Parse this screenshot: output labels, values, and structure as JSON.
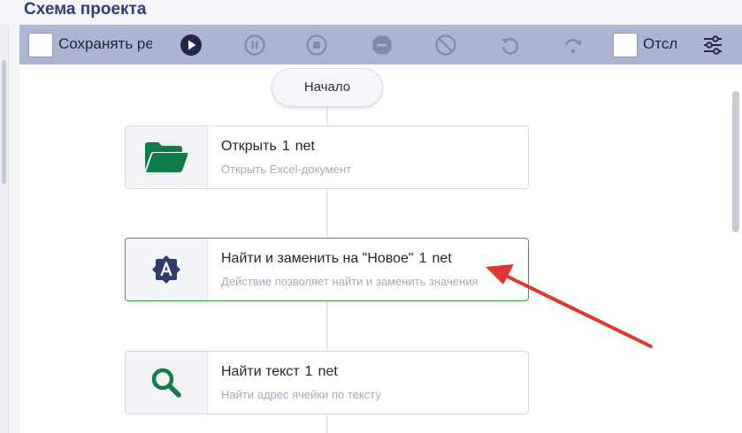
{
  "panel": {
    "title": "Схема проекта"
  },
  "toolbar": {
    "save_label": "Сохранять ре",
    "debug_label": "Отсл",
    "icons": [
      "play-icon",
      "pause-icon",
      "stop-icon",
      "block-icon",
      "forbidden-icon",
      "undo-icon",
      "redo-icon",
      "settings-sliders-icon"
    ],
    "colors": {
      "active_icon": "#232845",
      "disabled_icon": "#7f8bab",
      "bar": "#aab6d3"
    }
  },
  "flow": {
    "start_label": "Начало",
    "nodes": [
      {
        "title": "Открыть",
        "number": "1",
        "tag": "net",
        "subtitle": "Открыть Excel-документ",
        "icon": "folder-open-icon"
      },
      {
        "title": "Найти и заменить на \"Новое\"",
        "number": "1",
        "tag": "net",
        "subtitle": "Действие позволяет найти и заменить значения",
        "icon": "find-replace-icon"
      },
      {
        "title": "Найти текст",
        "number": "1",
        "tag": "net",
        "subtitle": "Найти адрес ячейки по тексту",
        "icon": "search-icon"
      }
    ]
  },
  "colors": {
    "icon_green": "#107c47",
    "active_border": "#3aa04d",
    "annotation_arrow": "#e0372c"
  }
}
